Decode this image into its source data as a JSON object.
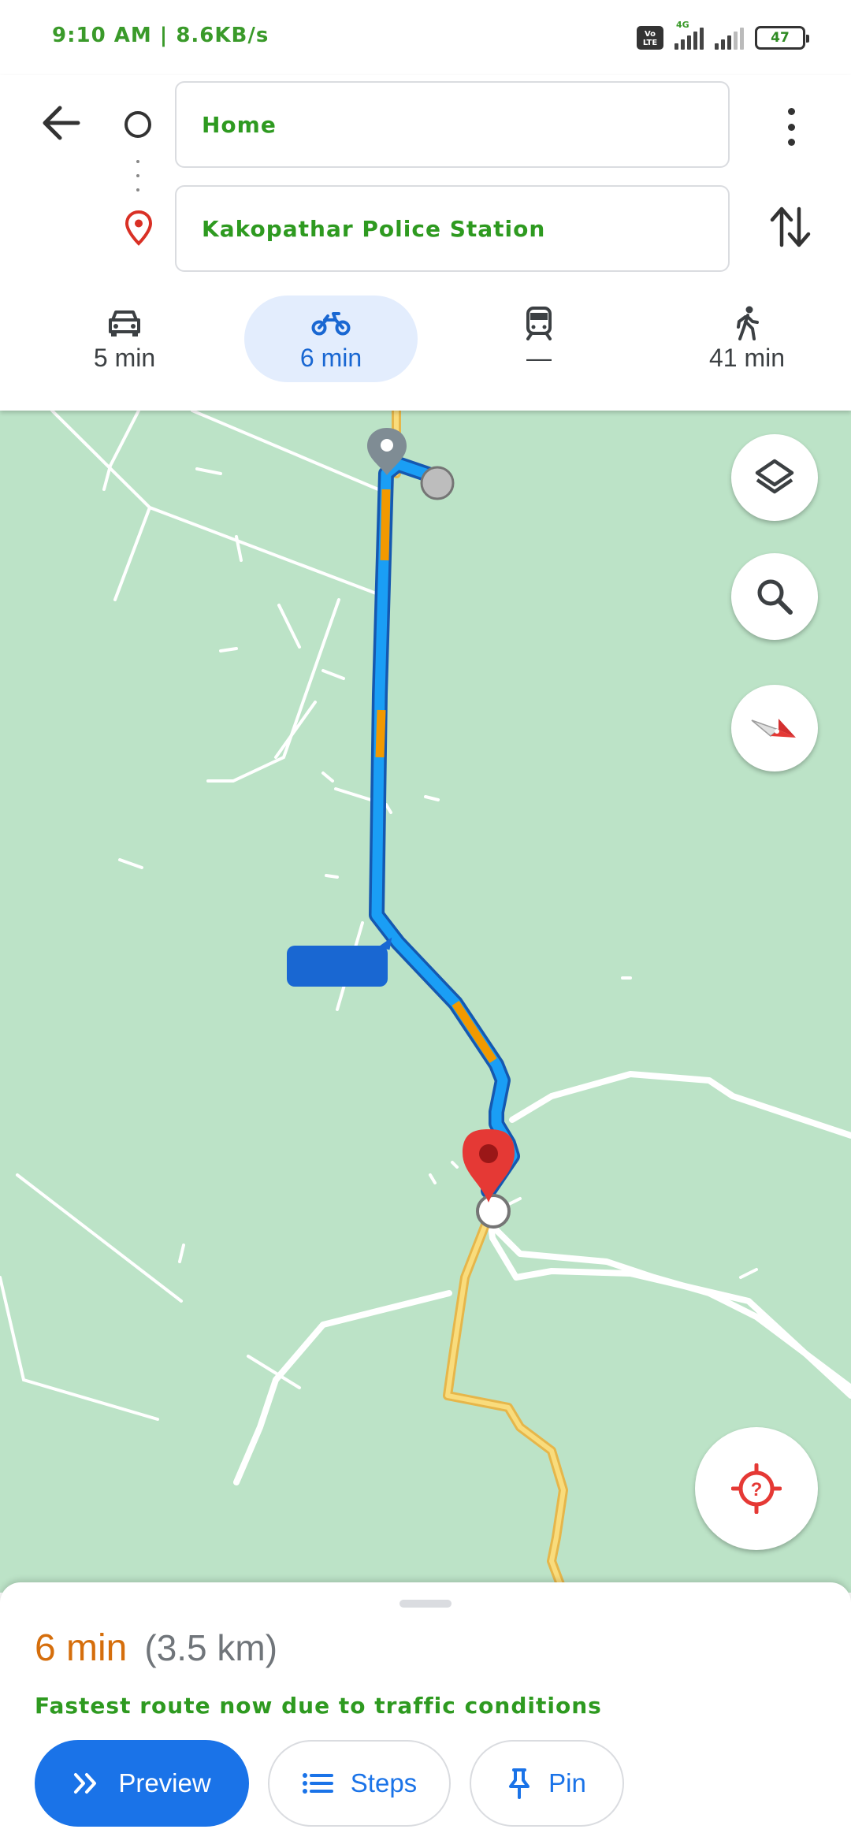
{
  "status_bar": {
    "time_speed": "9:10 AM | 8.6KB/s",
    "volte": "Vo LTE",
    "network": "4G",
    "battery": "47"
  },
  "header": {
    "origin": "Home",
    "destination": "Kakopathar Police Station",
    "icons": {
      "back": "back-arrow-icon",
      "more": "more-vert-icon",
      "swap": "swap-vert-icon"
    }
  },
  "modes": [
    {
      "name": "drive",
      "icon": "car-icon",
      "label": "5 min",
      "selected": false
    },
    {
      "name": "two-wheeler",
      "icon": "motorcycle-icon",
      "label": "6 min",
      "selected": true
    },
    {
      "name": "transit",
      "icon": "train-icon",
      "label": "—",
      "selected": false
    },
    {
      "name": "walk",
      "icon": "walk-icon",
      "label": "41 min",
      "selected": false
    }
  ],
  "map": {
    "controls": [
      "layers-icon",
      "search-icon",
      "compass-icon",
      "my-location-icon"
    ],
    "colors": {
      "land": "#bce3c7",
      "route": "#1a9ef5",
      "route_traffic": "#f29900",
      "highway": "#f6cf65",
      "destination_pin": "#e53935"
    }
  },
  "bottom_sheet": {
    "duration": "6 min",
    "distance": "(3.5 km)",
    "note": "Fastest route now due to traffic conditions",
    "buttons": {
      "preview": "Preview",
      "steps": "Steps",
      "pin": "Pin"
    }
  }
}
